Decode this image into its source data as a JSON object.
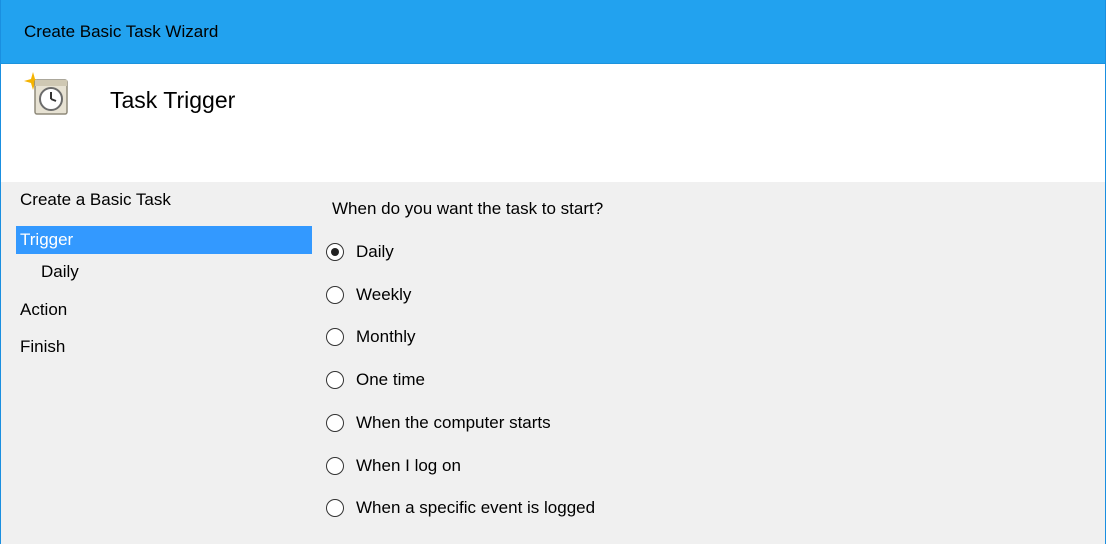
{
  "window": {
    "title": "Create Basic Task Wizard"
  },
  "header": {
    "title": "Task Trigger",
    "icon": "clock-task-icon"
  },
  "sidebar": {
    "items": [
      {
        "label": "Create a Basic Task",
        "selected": false
      },
      {
        "label": "Trigger",
        "selected": true
      },
      {
        "label": "Daily",
        "selected": false
      },
      {
        "label": "Action",
        "selected": false
      },
      {
        "label": "Finish",
        "selected": false
      }
    ]
  },
  "main": {
    "question": "When do you want the task to start?",
    "options": [
      {
        "label": "Daily",
        "checked": true
      },
      {
        "label": "Weekly",
        "checked": false
      },
      {
        "label": "Monthly",
        "checked": false
      },
      {
        "label": "One time",
        "checked": false
      },
      {
        "label": "When the computer starts",
        "checked": false
      },
      {
        "label": "When I log on",
        "checked": false
      },
      {
        "label": "When a specific event is logged",
        "checked": false
      }
    ]
  },
  "colors": {
    "titlebar": "#22a2ef",
    "selection": "#3399ff"
  }
}
